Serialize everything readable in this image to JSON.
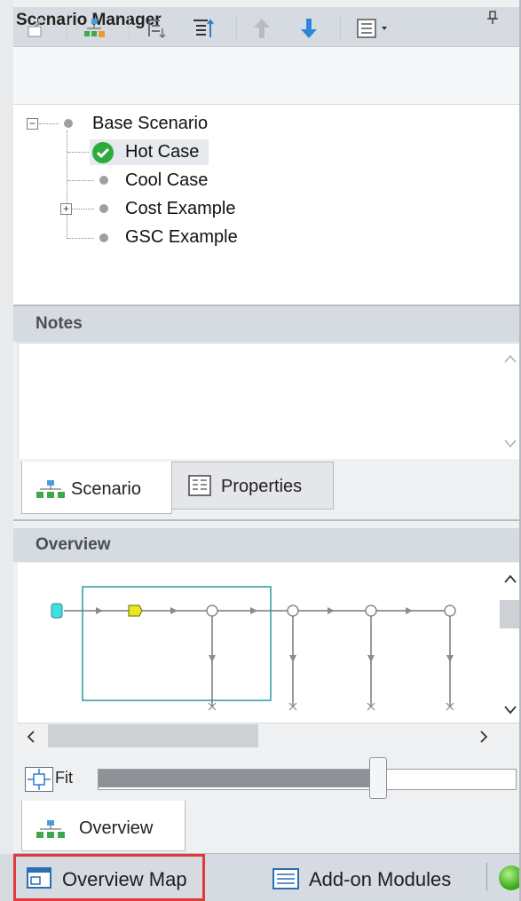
{
  "scenario_manager": {
    "title": "Scenario Manager",
    "pin_icon": "pin-icon",
    "toolbar_icons": [
      "new-scenario-icon",
      "create-child-icon",
      "sort-children-icon",
      "sort-descending-icon",
      "move-up-icon",
      "move-down-icon",
      "view-options-icon"
    ]
  },
  "tree": {
    "items": [
      {
        "label": "Base Scenario",
        "level": 0,
        "current": false,
        "expandable": true
      },
      {
        "label": "Hot Case",
        "level": 1,
        "current": true,
        "expandable": false
      },
      {
        "label": "Cool Case",
        "level": 1,
        "current": false,
        "expandable": false
      },
      {
        "label": "Cost Example",
        "level": 1,
        "current": false,
        "expandable": true
      },
      {
        "label": "GSC Example",
        "level": 1,
        "current": false,
        "expandable": false
      }
    ]
  },
  "notes": {
    "title": "Notes"
  },
  "tabs_top": [
    {
      "label": "Scenario",
      "active": true
    },
    {
      "label": "Properties",
      "active": false
    }
  ],
  "overview": {
    "title": "Overview",
    "fit_label": "Fit",
    "zoom_percent": 67
  },
  "tabs_bottom": [
    {
      "label": "Overview",
      "active": true
    }
  ],
  "bottom_bar": {
    "overview_map": "Overview Map",
    "addon_modules": "Add-on Modules"
  },
  "colors": {
    "highlight": "#e03a3a",
    "current_check": "#2eaa3f",
    "selection_box": "#2a9aa0",
    "junction_fill": "#e8e820",
    "source_fill": "#40e0e0"
  }
}
